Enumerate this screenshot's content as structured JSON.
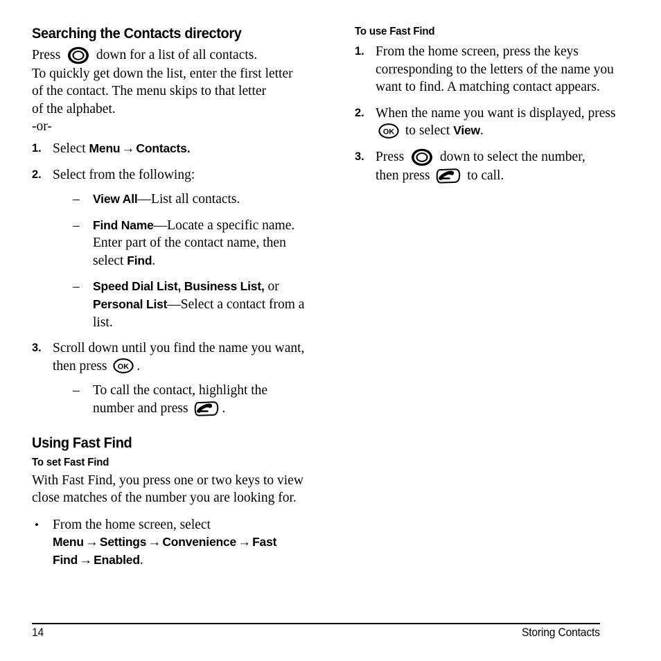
{
  "page": {
    "number": "14",
    "section_label": "Storing Contacts"
  },
  "icons": {
    "nav": "navigation-key-icon",
    "ok": "ok-key-icon",
    "call": "call-key-icon",
    "ok_label": "OK"
  },
  "left_column": {
    "heading": "Searching the Contacts directory",
    "intro": {
      "press_word": "Press",
      "after_icon": "down for a list of all contacts.",
      "line2": "To quickly get down the list, enter the first letter",
      "line3": "of the contact. The menu skips to that letter",
      "line4": "of the alphabet."
    },
    "or_text": "-or-",
    "steps": [
      {
        "num": "1.",
        "prefix": "Select ",
        "ui1": "Menu",
        "arrow": "→",
        "ui2": "Contacts.",
        "suffix": ""
      },
      {
        "num": "2.",
        "text": "Select from the following:",
        "subitems": [
          {
            "dash": "–",
            "ui": "View All",
            "emdash": "—",
            "text": "List all contacts."
          },
          {
            "dash": "–",
            "ui": "Find Name",
            "emdash": "—",
            "text": "Locate a specific name. Enter part of the contact name, then select ",
            "ui_tail": "Find",
            "tail": "."
          },
          {
            "dash": "–",
            "ui": "Speed Dial List, Business List,",
            "mid": " or ",
            "ui2": "Personal List",
            "emdash": "—",
            "text": "Select a contact from a list."
          }
        ]
      },
      {
        "num": "3.",
        "text_a": "Scroll down until you find the name you want, then press",
        "text_b": ".",
        "subitems": [
          {
            "dash": "–",
            "text_a": "To call the contact, highlight the number and press",
            "text_b": "."
          }
        ]
      }
    ],
    "fastfind_heading": "Using Fast Find",
    "set_heading": "To set Fast Find",
    "set_para_line1": "With Fast Find, you press one or two keys to view",
    "set_para_line2": "close matches of the number you are looking for.",
    "set_bullet": {
      "bullet": "•",
      "prefix": "From the home screen, select ",
      "ui1": "Menu",
      "arrow": "→",
      "ui2": "Settings",
      "ui3": "Convenience",
      "ui4": "Fast Find",
      "ui5": "Enabled",
      "suffix": "."
    }
  },
  "right_column": {
    "heading": "To use Fast Find",
    "steps": [
      {
        "num": "1.",
        "text": "From the home screen, press the keys corresponding to the letters of the name you want to find. A matching contact appears."
      },
      {
        "num": "2.",
        "text_a": "When the name you want is displayed, press",
        "text_b": "to select ",
        "ui": "View",
        "text_c": "."
      },
      {
        "num": "3.",
        "press_word": "Press",
        "text_a": "down to select the number,",
        "text_b": "then press",
        "text_c": "to call."
      }
    ]
  }
}
